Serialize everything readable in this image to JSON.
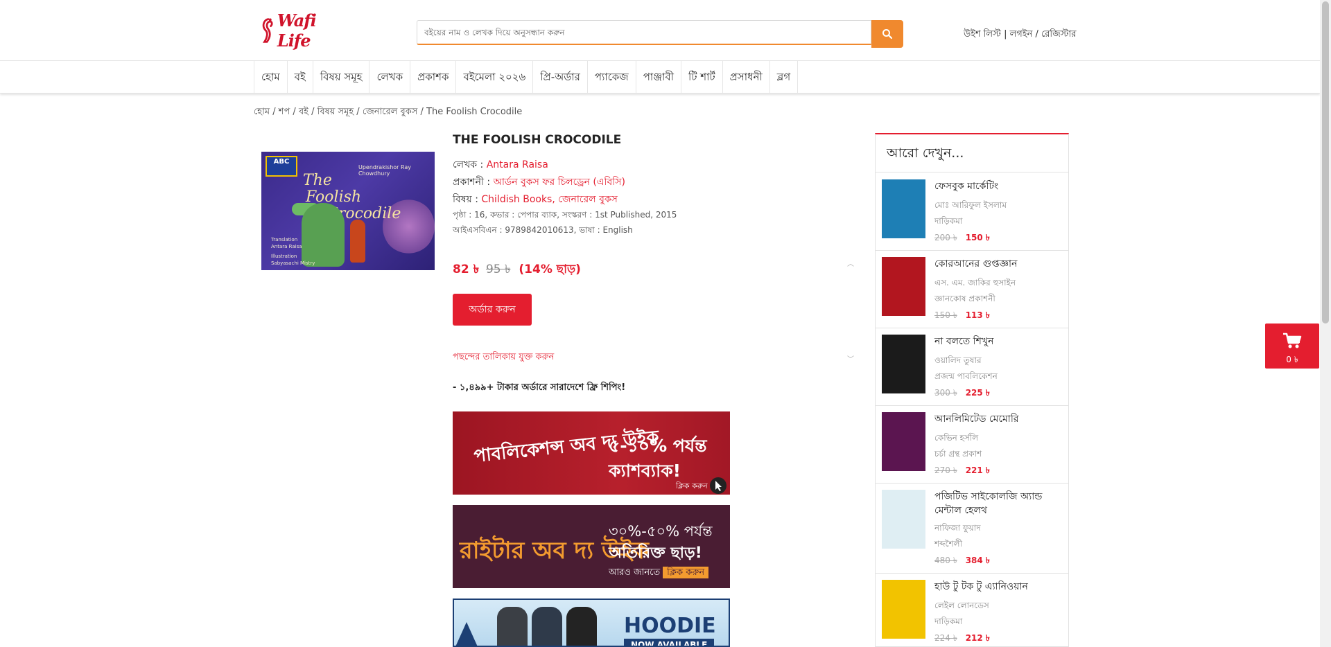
{
  "header": {
    "logo_text": "Wafi Life",
    "search_placeholder": "বইয়ের নাম ও লেখক দিয়ে অনুসন্ধান করুন",
    "wishlist": "উইশ লিস্ট",
    "separator": "|",
    "login": "লগইন",
    "slash": "/",
    "register": "রেজিস্টার"
  },
  "nav": [
    "হোম",
    "বই",
    "বিষয় সমূহ",
    "লেখক",
    "প্রকাশক",
    "বইমেলা ২০২৬",
    "প্রি-অর্ডার",
    "প্যাকেজ",
    "পাঞ্জাবী",
    "টি শার্ট",
    "প্রসাধনী",
    "ব্লগ"
  ],
  "breadcrumb": [
    "হোম",
    "শপ",
    "বই",
    "বিষয় সমূহ",
    "জেনারেল বুকস",
    "The Foolish Crocodile"
  ],
  "cover": {
    "badge": "ABC",
    "author_top": "Upendrakishor Ray Chowdhury",
    "title_line1": "The",
    "title_line2": "Foolish",
    "title_line3": "Crocodile",
    "credit_label1": "Translation",
    "credit_name1": "Antara Raisa",
    "credit_label2": "Illustration",
    "credit_name2": "Sabyasachi Mistry"
  },
  "product": {
    "title": "THE FOOLISH CROCODILE",
    "author_label": "লেখক :",
    "author": "Antara Raisa",
    "publisher_label": "প্রকাশনী :",
    "publisher": "আর্ডন বুকস ফর চিলড্রেন (এবিসি)",
    "subject_label": "বিষয় :",
    "subject1": "Childish Books",
    "subject_sep": ",",
    "subject2": "জেনারেল বুকস",
    "details1": "পৃষ্ঠা : 16, কভার : পেপার ব্যাক, সংস্করণ : 1st Published, 2015",
    "details2": "আইএসবিএন : 9789842010613, ভাষা : English",
    "price": "82 ৳",
    "old_price": "95 ৳",
    "discount": "(14% ছাড়)",
    "order_button": "অর্ডার করুন",
    "wishlist_link": "পছন্দের তালিকায় যুক্ত করুন",
    "shipping_note": "- ১,৪৯৯+ টাকার অর্ডারে সারাদেশে ফ্রি শিপিং!"
  },
  "banners": {
    "b1_left": "পাবলিকেশন্স অব দ্য উইক",
    "b1_right1": "৫-১০% পর্যন্ত",
    "b1_right2": "ক্যাশব্যাক!",
    "b1_click": "ক্লিক করুন",
    "b2_left": "রাইটার অব দ্য উইক",
    "b2_right1": "৩০%-৫০% পর্যন্ত",
    "b2_right2": "অতিরিক্ত ছাড়!",
    "b2_more": "আরও জানতে",
    "b2_click": "ক্লিক করুন",
    "b3_title": "HOODIE",
    "b3_sub": "NOW AVAILABLE"
  },
  "sidebar": {
    "title": "আরো দেখুন...",
    "items": [
      {
        "name": "ফেসবুক মার্কেটিং",
        "author": "মোঃ আরিফুল ইসলাম",
        "publisher": "দাড়িকমা",
        "old_price": "200 ৳",
        "price": "150 ৳",
        "color": "#1e7fb5"
      },
      {
        "name": "কোরআনের গুপ্তজ্ঞান",
        "author": "এস. এম. জাকির হুসাইন",
        "publisher": "জ্ঞানকোষ প্রকাশনী",
        "old_price": "150 ৳",
        "price": "113 ৳",
        "color": "#b2161f"
      },
      {
        "name": "না বলতে শিখুন",
        "author": "ওয়ালিদ তুষার",
        "publisher": "প্রজন্ম পাবলিকেশন",
        "old_price": "300 ৳",
        "price": "225 ৳",
        "color": "#1b1b1b"
      },
      {
        "name": "আনলিমিটেড মেমোরি",
        "author": "কেভিন হর্সলি",
        "publisher": "চর্চা গ্রন্থ প্রকাশ",
        "old_price": "270 ৳",
        "price": "221 ৳",
        "color": "#5b1550"
      },
      {
        "name": "পজিটিভ সাইকোলজি অ্যান্ড মেন্টাল হেলথ",
        "author": "নাফিজা ফুয়াদ",
        "publisher": "শব্দশৈলী",
        "old_price": "480 ৳",
        "price": "384 ৳",
        "color": "#dfeef3"
      },
      {
        "name": "হাউ টু টক টু এ্যানিওয়ান",
        "author": "লেইল লোনডেস",
        "publisher": "দাড়িকমা",
        "old_price": "224 ৳",
        "price": "212 ৳",
        "color": "#f2c300"
      }
    ]
  },
  "cart": {
    "amount": "0 ৳"
  },
  "colors": {
    "accent": "#e41e2f",
    "search": "#f0892e"
  }
}
